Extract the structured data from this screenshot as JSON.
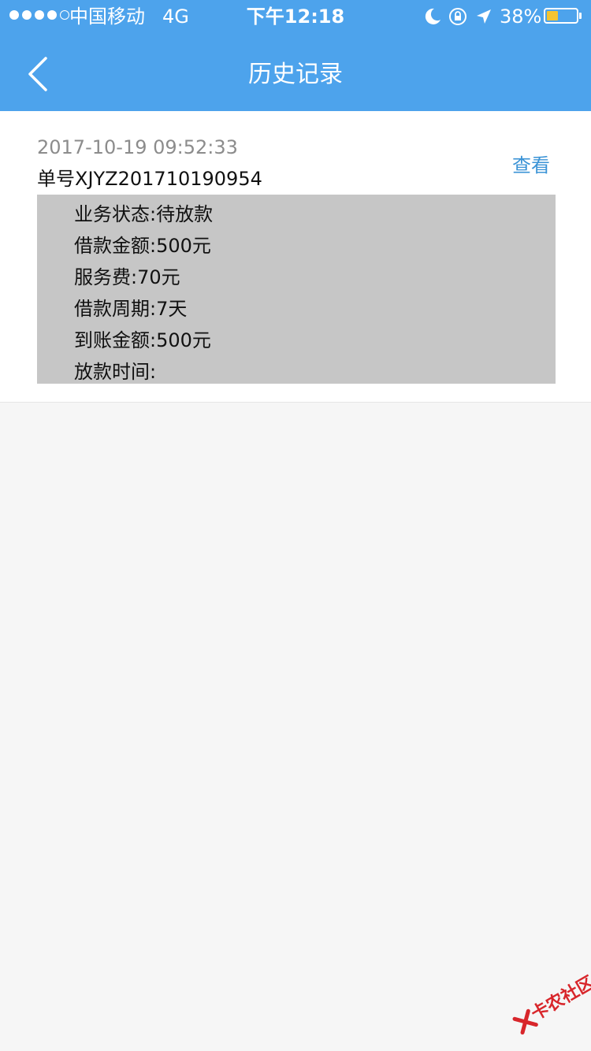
{
  "status_bar": {
    "carrier": "中国移动",
    "network": "4G",
    "time": "下午12:18",
    "battery_percent": "38%",
    "battery_level": 0.38,
    "battery_color": "#f4c430",
    "icons": [
      "moon-icon",
      "rotation-lock-icon",
      "location-arrow-icon"
    ]
  },
  "nav": {
    "title": "历史记录",
    "back_icon": "chevron-left-icon",
    "background": "#4da3ec"
  },
  "record": {
    "time": "2017-10-19 09:52:33",
    "order_no": "单号XJYZ201710190954",
    "view_label": "查看",
    "details": [
      "业务状态:待放款",
      "借款金额:500元",
      "服务费:70元",
      "借款周期:7天",
      "到账金额:500元",
      "放款时间:"
    ]
  },
  "watermark": {
    "text": "卡农社区"
  }
}
